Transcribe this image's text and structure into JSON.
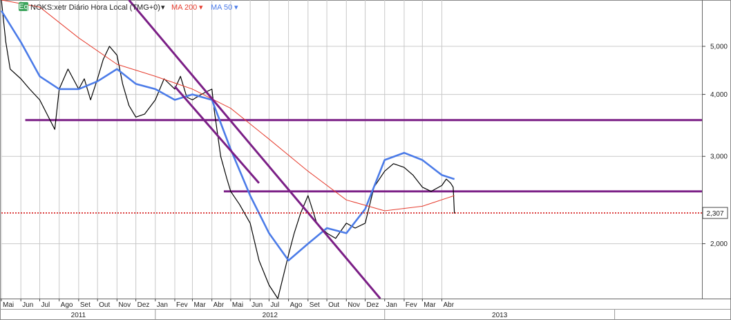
{
  "header": {
    "badge": "Eq",
    "symbol_label": "NOKS:xetr Diário Hora Local (TMG+0)",
    "ma200_label": "MA 200",
    "ma50_label": "MA 50",
    "dropdown_glyph": "▾"
  },
  "colors": {
    "price": "#000000",
    "ma200": "#e63c2e",
    "ma50": "#4b7be8",
    "trendline": "#7b1f86",
    "current_level": "#d00000",
    "grid": "#c8c8c8",
    "badge_bg": "#3aa35a"
  },
  "chart_data": {
    "type": "line",
    "y_scale": "log",
    "ylim": [
      1.55,
      6.2
    ],
    "y_ticks": [
      "2,000",
      "3,000",
      "4,000",
      "5,000"
    ],
    "y_tick_values": [
      2.0,
      3.0,
      4.0,
      5.0
    ],
    "current_value_label": "2,307",
    "current_value": 2.307,
    "x_start": "2010-05-01",
    "x_end": "2013-05-20",
    "x_tick_labels": [
      "Mai",
      "Jun",
      "Jul",
      "Ago",
      "Set",
      "Out",
      "Nov",
      "Dez",
      "Jan",
      "Fev",
      "Mar",
      "Abr",
      "Mai",
      "Jun",
      "Jul",
      "Ago",
      "Set",
      "Out",
      "Nov",
      "Dez",
      "Jan",
      "Fev",
      "Mar",
      "Abr"
    ],
    "x_tick_dates": [
      "2010-05-01",
      "2010-06-01",
      "2010-07-01",
      "2010-08-01",
      "2010-09-01",
      "2010-10-01",
      "2010-11-01",
      "2010-12-01",
      "2011-01-01",
      "2011-02-01",
      "2011-03-01",
      "2011-04-01",
      "2011-05-01",
      "2011-06-01",
      "2011-07-01",
      "2011-08-01",
      "2011-09-01",
      "2011-10-01",
      "2011-11-01",
      "2011-12-01",
      "2012-01-01",
      "2012-02-01",
      "2012-03-01",
      "2012-04-01"
    ],
    "year_labels": [
      "2011",
      "2012",
      "2013"
    ],
    "year_dates": [
      "2011-01-01",
      "2012-01-01",
      "2013-01-01"
    ],
    "series": [
      {
        "name": "NOKS:xetr",
        "x": [
          "2010-05-01",
          "2010-05-08",
          "2010-05-15",
          "2010-06-01",
          "2010-06-15",
          "2010-07-01",
          "2010-07-15",
          "2010-07-25",
          "2010-08-01",
          "2010-08-15",
          "2010-09-01",
          "2010-09-10",
          "2010-09-20",
          "2010-10-01",
          "2010-10-10",
          "2010-10-20",
          "2010-11-01",
          "2010-11-10",
          "2010-11-20",
          "2010-12-01",
          "2010-12-15",
          "2011-01-01",
          "2011-01-15",
          "2011-02-01",
          "2011-02-10",
          "2011-02-20",
          "2011-03-01",
          "2011-03-15",
          "2011-04-01",
          "2011-04-05",
          "2011-04-15",
          "2011-04-25",
          "2011-05-01",
          "2011-05-15",
          "2011-06-01",
          "2011-06-15",
          "2011-07-01",
          "2011-07-15",
          "2011-08-01",
          "2011-08-10",
          "2011-08-20",
          "2011-09-01",
          "2011-09-15",
          "2011-10-01",
          "2011-10-15",
          "2011-11-01",
          "2011-11-15",
          "2011-12-01",
          "2011-12-15",
          "2012-01-01",
          "2012-01-15",
          "2012-02-01",
          "2012-02-15",
          "2012-03-01",
          "2012-03-15",
          "2012-04-01",
          "2012-04-08",
          "2012-04-15",
          "2012-04-19",
          "2012-04-21"
        ],
        "y": [
          6.4,
          5.1,
          4.5,
          4.3,
          4.1,
          3.9,
          3.6,
          3.4,
          4.1,
          4.5,
          4.1,
          4.3,
          3.9,
          4.3,
          4.7,
          5.0,
          4.8,
          4.2,
          3.8,
          3.6,
          3.65,
          3.9,
          4.3,
          4.1,
          4.35,
          3.95,
          3.9,
          4.0,
          4.1,
          3.7,
          3.0,
          2.7,
          2.55,
          2.4,
          2.2,
          1.85,
          1.65,
          1.55,
          1.9,
          2.1,
          2.3,
          2.5,
          2.2,
          2.1,
          2.05,
          2.2,
          2.15,
          2.2,
          2.6,
          2.8,
          2.9,
          2.85,
          2.75,
          2.6,
          2.55,
          2.62,
          2.7,
          2.65,
          2.6,
          2.3
        ]
      },
      {
        "name": "MA 50",
        "x": [
          "2010-05-01",
          "2010-06-01",
          "2010-07-01",
          "2010-08-01",
          "2010-09-01",
          "2010-10-01",
          "2010-11-01",
          "2010-12-01",
          "2011-01-01",
          "2011-02-01",
          "2011-03-01",
          "2011-04-01",
          "2011-05-01",
          "2011-06-01",
          "2011-07-01",
          "2011-08-01",
          "2011-09-01",
          "2011-10-01",
          "2011-11-01",
          "2011-12-01",
          "2012-01-01",
          "2012-02-01",
          "2012-03-01",
          "2012-04-01",
          "2012-04-21"
        ],
        "y": [
          5.9,
          5.1,
          4.35,
          4.1,
          4.1,
          4.25,
          4.5,
          4.2,
          4.1,
          3.9,
          4.0,
          3.9,
          3.1,
          2.5,
          2.1,
          1.85,
          2.0,
          2.15,
          2.1,
          2.35,
          2.95,
          3.05,
          2.95,
          2.75,
          2.7
        ]
      },
      {
        "name": "MA 200",
        "x": [
          "2010-05-01",
          "2010-07-01",
          "2010-09-01",
          "2010-11-01",
          "2011-01-01",
          "2011-03-01",
          "2011-05-01",
          "2011-07-01",
          "2011-09-01",
          "2011-11-01",
          "2012-01-01",
          "2012-03-01",
          "2012-04-21"
        ],
        "y": [
          6.5,
          6.0,
          5.2,
          4.6,
          4.35,
          4.1,
          3.75,
          3.25,
          2.8,
          2.45,
          2.33,
          2.38,
          2.5
        ]
      }
    ],
    "annotations": {
      "trendlines": [
        {
          "from": [
            "2010-11-20",
            6.3
          ],
          "to": [
            "2011-12-25",
            1.42
          ]
        },
        {
          "from": [
            "2011-02-01",
            4.15
          ],
          "to": [
            "2011-06-15",
            2.65
          ]
        }
      ],
      "horizontal_lines": [
        {
          "value": 3.55,
          "from": "2010-06-08",
          "to": "2013-05-20"
        },
        {
          "value": 2.55,
          "from": "2011-04-20",
          "to": "2013-05-20"
        }
      ]
    }
  }
}
